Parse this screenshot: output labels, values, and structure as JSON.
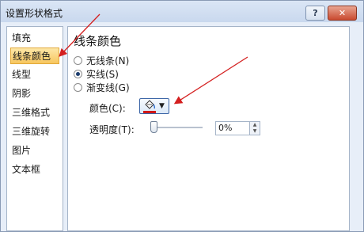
{
  "window": {
    "title": "设置形状格式",
    "help_label": "?",
    "close_label": "✕"
  },
  "sidebar": {
    "items": [
      {
        "label": "填充"
      },
      {
        "label": "线条颜色"
      },
      {
        "label": "线型"
      },
      {
        "label": "阴影"
      },
      {
        "label": "三维格式"
      },
      {
        "label": "三维旋转"
      },
      {
        "label": "图片"
      },
      {
        "label": "文本框"
      }
    ],
    "active_index": 1
  },
  "panel": {
    "title": "线条颜色",
    "options": [
      {
        "label": "无线条(N)",
        "selected": false
      },
      {
        "label": "实线(S)",
        "selected": true
      },
      {
        "label": "渐变线(G)",
        "selected": false
      }
    ],
    "color_label": "颜色(C):",
    "color_value": "#d01818",
    "transparency_label": "透明度(T):",
    "transparency_value": "0%"
  },
  "colors": {
    "annotation_arrow": "#d42020",
    "accent": "#f7c65e"
  }
}
